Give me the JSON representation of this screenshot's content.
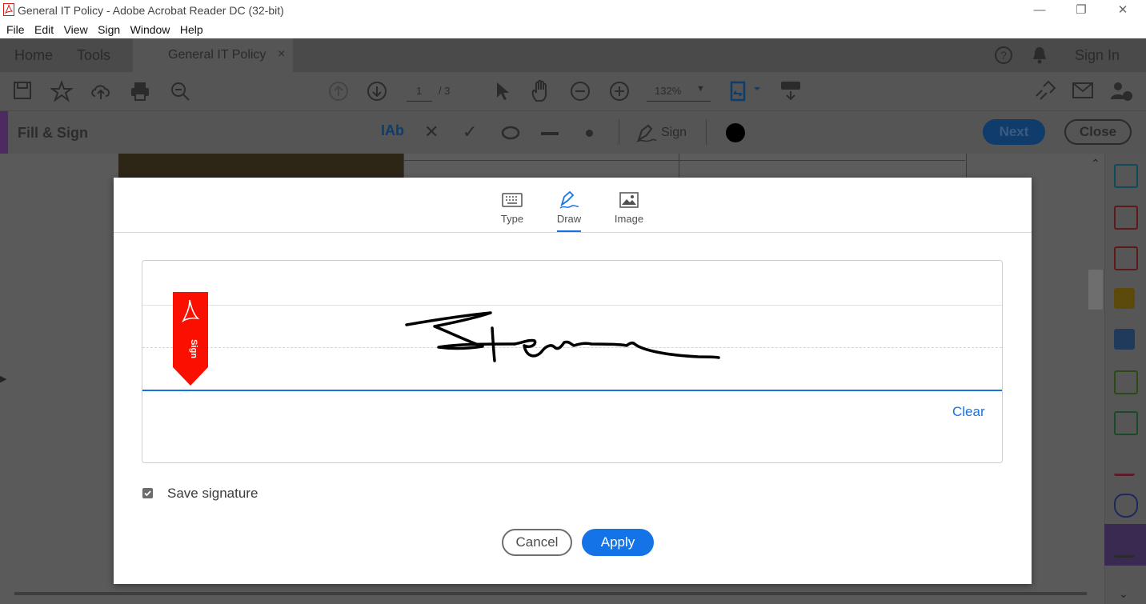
{
  "window": {
    "title": "General IT Policy - Adobe Acrobat Reader DC (32-bit)",
    "controls": [
      "minimize",
      "restore",
      "close"
    ]
  },
  "menu": [
    "File",
    "Edit",
    "View",
    "Sign",
    "Window",
    "Help"
  ],
  "tabs": {
    "home": "Home",
    "tools": "Tools",
    "document": "General IT Policy",
    "close_glyph": "×",
    "sign_in": "Sign In"
  },
  "toolbar": {
    "page_current": "1",
    "page_total": "/ 3",
    "zoom": "132%"
  },
  "fill_sign": {
    "title": "Fill & Sign",
    "text_tool": "Ab",
    "sign_label": "Sign",
    "next_label": "Next",
    "close_label": "Close"
  },
  "dialog": {
    "tabs": [
      {
        "label": "Type",
        "icon": "keyboard-icon"
      },
      {
        "label": "Draw",
        "icon": "pen-draw-icon"
      },
      {
        "label": "Image",
        "icon": "image-icon"
      }
    ],
    "selected_tab": "Draw",
    "sign_marker_label": "Sign",
    "clear_label": "Clear",
    "save_signature_label": "Save signature",
    "save_signature_checked": true,
    "cancel_label": "Cancel",
    "apply_label": "Apply"
  },
  "colors": {
    "accent": "#1473e6",
    "sign_marker": "#fa0f00",
    "fill_sign_bar": "#4d2a62"
  }
}
